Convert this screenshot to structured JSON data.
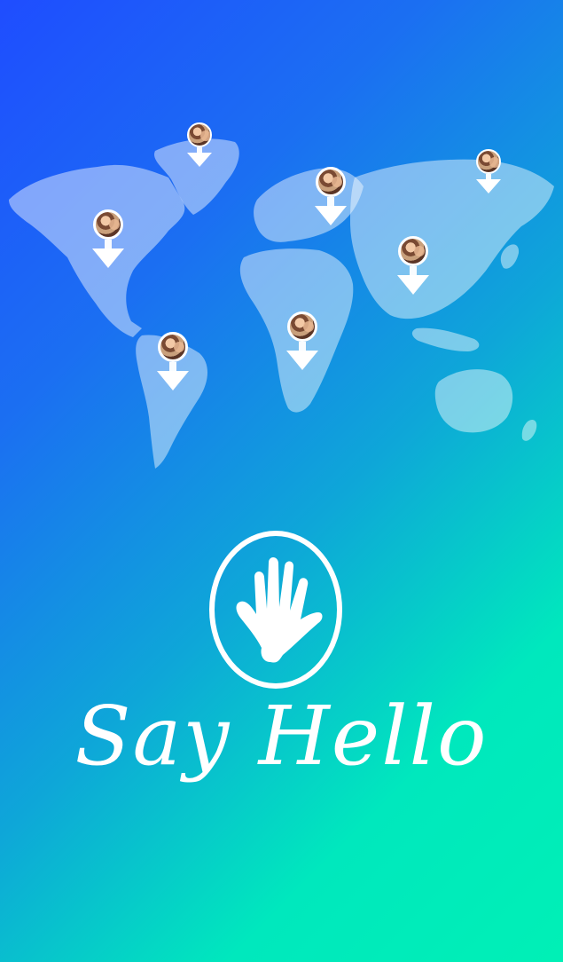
{
  "splash": {
    "title": "Say Hello",
    "logo_icon": "waving-hand-icon",
    "map_icon": "world-map",
    "pin_icon": "location-pin-icon",
    "colors": {
      "gradient_start": "#1f4dff",
      "gradient_mid": "#0ea7d8",
      "gradient_end": "#00f0b6",
      "foreground": "#ffffff"
    }
  },
  "pins": [
    {
      "region": "greenland"
    },
    {
      "region": "north-america"
    },
    {
      "region": "south-america"
    },
    {
      "region": "europe"
    },
    {
      "region": "africa"
    },
    {
      "region": "asia"
    },
    {
      "region": "east-russia"
    }
  ]
}
